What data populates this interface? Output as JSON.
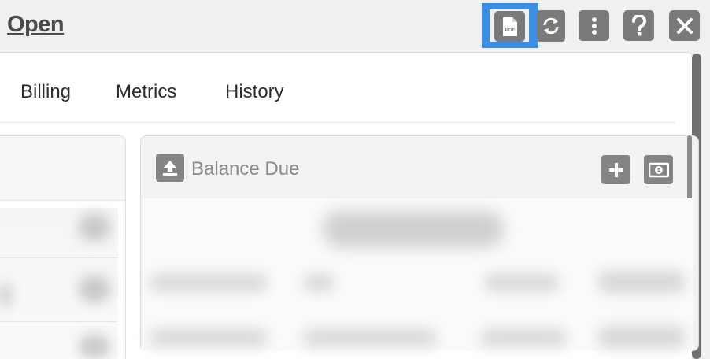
{
  "header": {
    "title": "Open",
    "toolbar": {
      "pdf_icon": "pdf-icon",
      "refresh_icon": "refresh-icon",
      "more_icon": "vertical-dots-icon",
      "help_icon": "question-icon",
      "close_icon": "close-icon",
      "pdf_badge_text": "PDF"
    }
  },
  "tabs": [
    {
      "label": "Billing"
    },
    {
      "label": "Metrics"
    },
    {
      "label": "History"
    }
  ],
  "balance_card": {
    "title": "Balance Due",
    "icons": {
      "upload": "upload-icon",
      "add": "plus-icon",
      "payment": "money-icon"
    }
  },
  "colors": {
    "highlight": "#3a8ee6",
    "icon_gray": "#7a7a7a",
    "title_gray": "#4a4a4a"
  }
}
